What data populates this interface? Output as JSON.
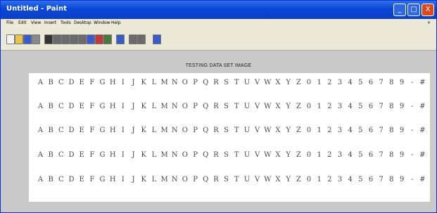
{
  "window": {
    "title": "Untitled - Paint",
    "controls": {
      "minimize": "_",
      "maximize": "□",
      "close": "X"
    }
  },
  "menubar": {
    "items": [
      "File",
      "Edit",
      "View",
      "Insert",
      "Tools",
      "Desktop",
      "Window",
      "Help"
    ],
    "restore_label": "×"
  },
  "toolbar": {
    "tools": [
      {
        "icon": "new-file-icon",
        "color": "#f5f5f5"
      },
      {
        "icon": "open-folder-icon",
        "color": "#e8c44a"
      },
      {
        "icon": "save-icon",
        "color": "#3a5bc8"
      },
      {
        "icon": "print-icon",
        "color": "#8a8a8a"
      },
      {
        "icon": "arrow-icon",
        "color": "#333333"
      },
      {
        "icon": "zoom-in-icon",
        "color": "#6a6a6a"
      },
      {
        "icon": "zoom-out-icon",
        "color": "#6a6a6a"
      },
      {
        "icon": "pan-icon",
        "color": "#6a6a6a"
      },
      {
        "icon": "rotate-icon",
        "color": "#6a6a6a"
      },
      {
        "icon": "data-cursor-icon",
        "color": "#3a5bc8"
      },
      {
        "icon": "brush-icon",
        "color": "#c03a3a"
      },
      {
        "icon": "colorbar-icon",
        "color": "#4a7a3a"
      },
      {
        "icon": "legend-icon",
        "color": "#3a5bc8"
      },
      {
        "icon": "grid-icon",
        "color": "#6a6a6a"
      },
      {
        "icon": "insert-icon",
        "color": "#6a6a6a"
      },
      {
        "icon": "property-icon",
        "color": "#3a5bc8"
      }
    ]
  },
  "document": {
    "title": "TESTING DATA SET IMAGE",
    "rows": [
      [
        "A",
        "B",
        "C",
        "D",
        "E",
        "F",
        "G",
        "H",
        "I",
        "J",
        "K",
        "L",
        "M",
        "N",
        "O",
        "P",
        "Q",
        "R",
        "S",
        "T",
        "U",
        "V",
        "W",
        "X",
        "Y",
        "Z",
        "0",
        "1",
        "2",
        "3",
        "4",
        "5",
        "6",
        "7",
        "8",
        "9",
        "-",
        "#"
      ],
      [
        "A",
        "B",
        "C",
        "D",
        "E",
        "F",
        "G",
        "H",
        "I",
        "J",
        "K",
        "L",
        "M",
        "N",
        "O",
        "P",
        "Q",
        "R",
        "S",
        "T",
        "U",
        "V",
        "W",
        "X",
        "Y",
        "Z",
        "0",
        "1",
        "2",
        "3",
        "4",
        "5",
        "6",
        "7",
        "8",
        "9",
        "-",
        "#"
      ],
      [
        "A",
        "B",
        "C",
        "D",
        "E",
        "F",
        "G",
        "H",
        "I",
        "J",
        "K",
        "L",
        "M",
        "N",
        "O",
        "P",
        "Q",
        "R",
        "S",
        "T",
        "U",
        "V",
        "W",
        "X",
        "Y",
        "Z",
        "0",
        "1",
        "2",
        "3",
        "4",
        "5",
        "6",
        "7",
        "8",
        "9",
        "-",
        "#"
      ],
      [
        "A",
        "B",
        "C",
        "D",
        "E",
        "F",
        "G",
        "H",
        "I",
        "J",
        "K",
        "L",
        "M",
        "N",
        "O",
        "P",
        "Q",
        "R",
        "S",
        "T",
        "U",
        "V",
        "W",
        "X",
        "Y",
        "Z",
        "0",
        "1",
        "2",
        "3",
        "4",
        "5",
        "6",
        "7",
        "8",
        "9",
        "-",
        "#"
      ],
      [
        "A",
        "B",
        "C",
        "D",
        "E",
        "F",
        "G",
        "H",
        "I",
        "J",
        "K",
        "L",
        "M",
        "N",
        "O",
        "P",
        "Q",
        "R",
        "S",
        "T",
        "U",
        "V",
        "W",
        "X",
        "Y",
        "Z",
        "0",
        "1",
        "2",
        "3",
        "4",
        "5",
        "6",
        "7",
        "8",
        "9",
        "-",
        "#"
      ]
    ]
  }
}
